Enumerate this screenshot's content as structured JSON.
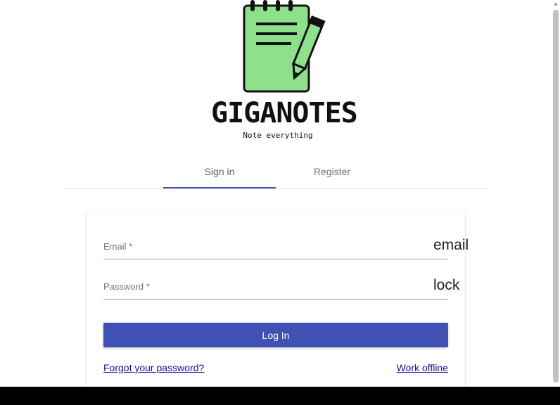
{
  "logo": {
    "title": "GIGANOTES",
    "tagline": "Note everything",
    "icon": "notepad-pencil-icon",
    "colors": {
      "notepad": "#8ee18a",
      "outline": "#111111"
    }
  },
  "tabs": [
    {
      "label": "Sign in",
      "active": true
    },
    {
      "label": "Register",
      "active": false
    }
  ],
  "form": {
    "email": {
      "label": "Email *",
      "value": "",
      "icon_text": "email"
    },
    "password": {
      "label": "Password *",
      "value": "",
      "icon_text": "lock"
    },
    "login_label": "Log In",
    "forgot_label": "Forgot your password?",
    "offline_label": "Work offline"
  },
  "colors": {
    "accent": "#3f51b5",
    "link": "#1a0dab"
  }
}
